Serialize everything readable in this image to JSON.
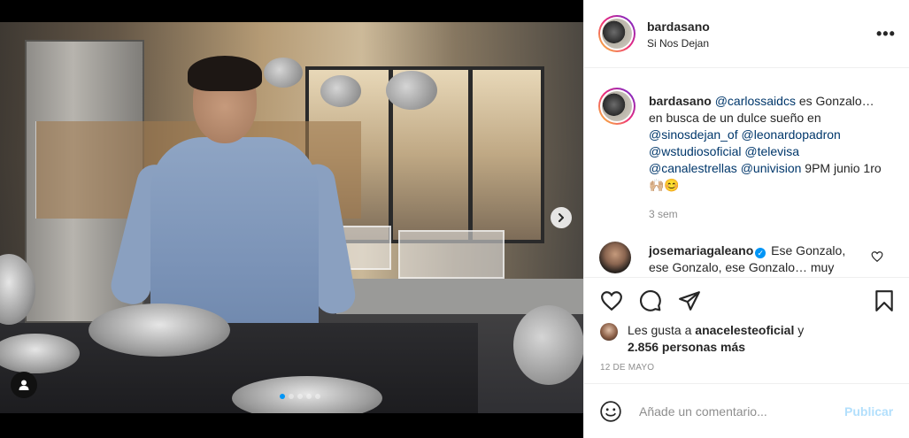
{
  "post": {
    "username": "bardasano",
    "location": "Si Nos Dejan",
    "more_label": "•••"
  },
  "caption": {
    "username": "bardasano",
    "parts": [
      {
        "type": "mention",
        "text": "@carlossaidcs"
      },
      {
        "type": "text",
        "text": " es Gonzalo… en busca de un dulce sueño en "
      },
      {
        "type": "mention",
        "text": "@sinosdejan_of"
      },
      {
        "type": "text",
        "text": " "
      },
      {
        "type": "mention",
        "text": "@leonardopadron"
      },
      {
        "type": "text",
        "text": " "
      },
      {
        "type": "mention",
        "text": "@wstudiosoficial"
      },
      {
        "type": "text",
        "text": " "
      },
      {
        "type": "mention",
        "text": "@televisa"
      },
      {
        "type": "text",
        "text": " "
      },
      {
        "type": "mention",
        "text": "@canalestrellas"
      },
      {
        "type": "text",
        "text": " "
      },
      {
        "type": "mention",
        "text": "@univision"
      },
      {
        "type": "text",
        "text": " 9PM junio 1ro 🙌🏼😊"
      }
    ],
    "time": "3 sem"
  },
  "comment": {
    "username": "josemariagaleano",
    "verified": true,
    "text": "Ese Gonzalo, ese Gonzalo, ese Gonzalo… muy"
  },
  "likes": {
    "prefix": "Les gusta a ",
    "user": "anacelesteoficial",
    "middle": " y",
    "count": "2.856 personas más"
  },
  "date": "12 DE MAYO",
  "add_comment": {
    "placeholder": "Añade un comentario...",
    "publish": "Publicar"
  },
  "icons": {
    "like": "heart-icon",
    "comment": "comment-icon",
    "share": "share-icon",
    "save": "bookmark-icon",
    "emoji": "emoji-icon",
    "next": "chevron-right-icon",
    "tag": "user-tag-icon"
  },
  "colors": {
    "mention": "#00376b",
    "secondary_text": "#8e8e8e",
    "publish_disabled": "#b2dffc",
    "verified": "#0095f6"
  }
}
